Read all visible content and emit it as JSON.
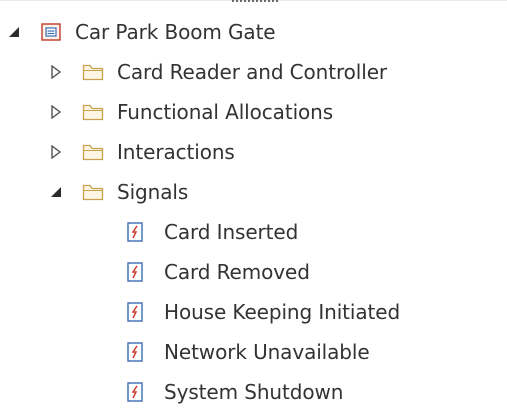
{
  "tree": {
    "root": {
      "label": "Car Park Boom Gate",
      "icon": "package-icon",
      "expanded": true
    },
    "folders": [
      {
        "label": "Card Reader and Controller",
        "icon": "folder-icon",
        "expanded": false
      },
      {
        "label": "Functional Allocations",
        "icon": "folder-icon",
        "expanded": false
      },
      {
        "label": "Interactions",
        "icon": "folder-icon",
        "expanded": false
      },
      {
        "label": "Signals",
        "icon": "folder-icon",
        "expanded": true
      }
    ],
    "signals": [
      {
        "label": "Card Inserted",
        "icon": "signal-icon"
      },
      {
        "label": "Card Removed",
        "icon": "signal-icon"
      },
      {
        "label": "House Keeping Initiated",
        "icon": "signal-icon"
      },
      {
        "label": "Network Unavailable",
        "icon": "signal-icon"
      },
      {
        "label": "System Shutdown",
        "icon": "signal-icon"
      }
    ]
  },
  "colors": {
    "text": "#333333",
    "package_border": "#c0392b",
    "package_fill": "#fdf1ea",
    "package_inner": "#3c6fb4",
    "folder_stroke": "#c9a04d",
    "folder_fill": "#fdf6e4",
    "signal_stroke": "#3a6cb0",
    "signal_bolt": "#d13a2f",
    "expander": "#4a4a4a"
  }
}
